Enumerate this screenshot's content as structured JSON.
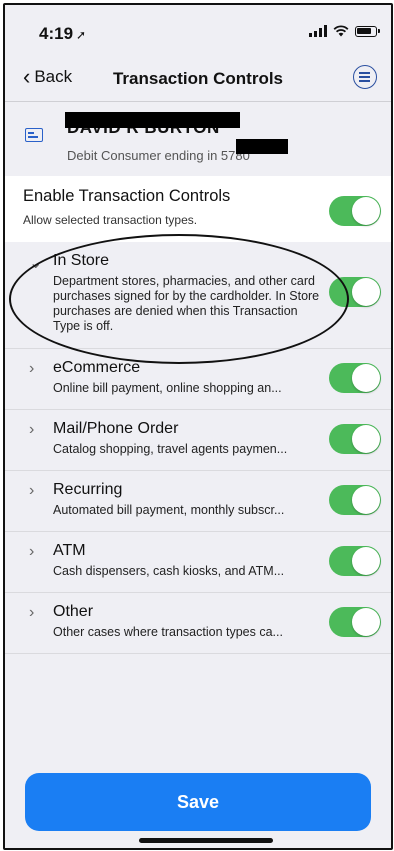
{
  "status_bar": {
    "time": "4:19",
    "location_icon": "navigation-arrow-icon"
  },
  "nav": {
    "back_label": "Back",
    "title": "Transaction Controls"
  },
  "account": {
    "name": "DAVID R BURTON",
    "description": "Debit Consumer ending in 5780"
  },
  "enable": {
    "title": "Enable Transaction Controls",
    "subtitle": "Allow selected transaction types.",
    "enabled": true
  },
  "transaction_types": [
    {
      "label": "In Store",
      "description": "Department stores, pharmacies, and other card purchases signed for by the cardholder. In Store purchases are denied when this Transaction Type is off.",
      "expanded": true,
      "enabled": true
    },
    {
      "label": "eCommerce",
      "description": "Online bill payment, online shopping an...",
      "expanded": false,
      "enabled": true
    },
    {
      "label": "Mail/Phone Order",
      "description": "Catalog shopping, travel agents paymen...",
      "expanded": false,
      "enabled": true
    },
    {
      "label": "Recurring",
      "description": "Automated bill payment, monthly subscr...",
      "expanded": false,
      "enabled": true
    },
    {
      "label": "ATM",
      "description": "Cash dispensers, cash kiosks, and ATM...",
      "expanded": false,
      "enabled": true
    },
    {
      "label": "Other",
      "description": "Other cases where transaction types ca...",
      "expanded": false,
      "enabled": true
    }
  ],
  "save_label": "Save",
  "colors": {
    "toggle_on": "#4cba5a",
    "save_button": "#1a7ef3",
    "accent": "#2a4fa0"
  }
}
